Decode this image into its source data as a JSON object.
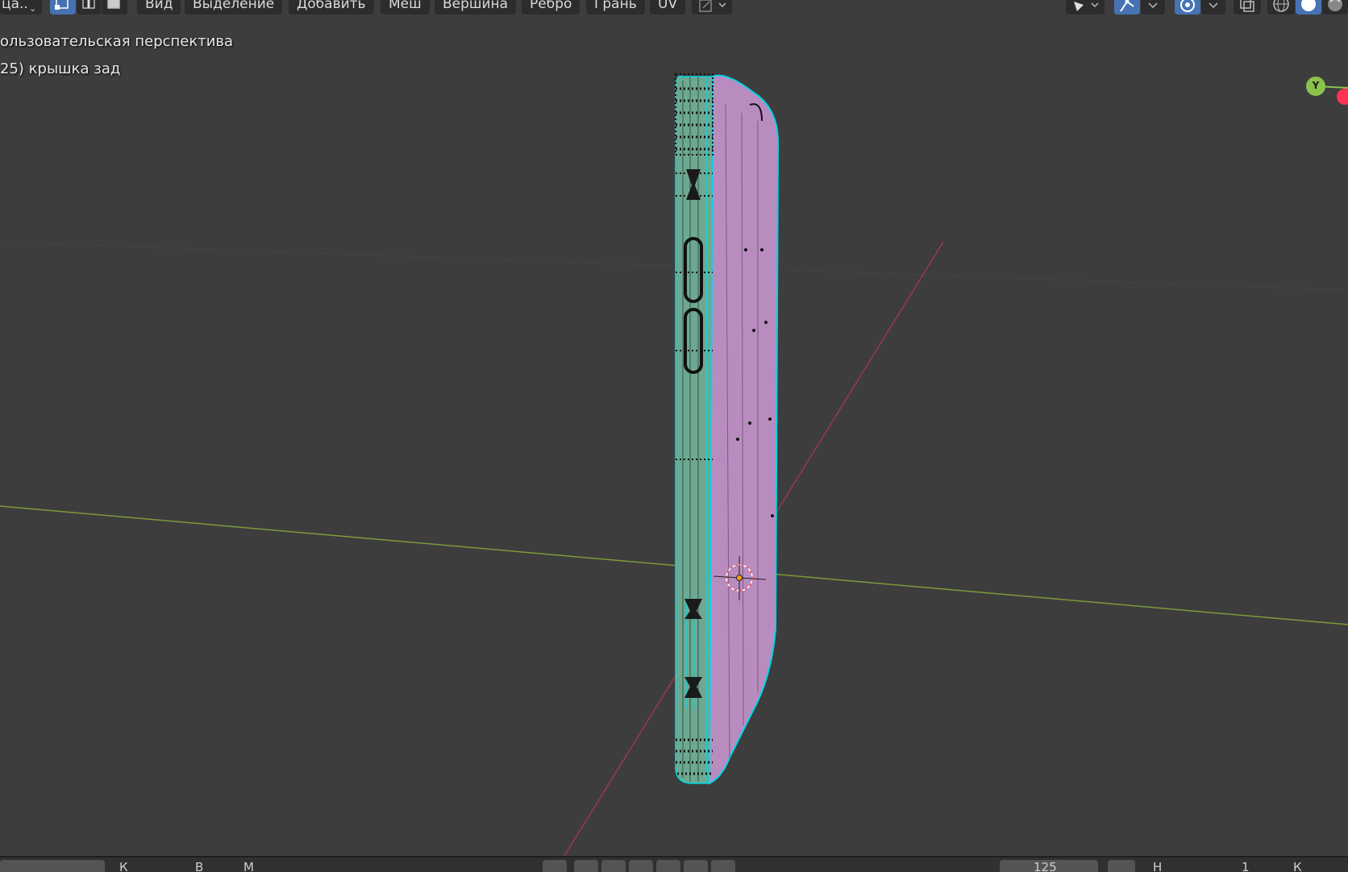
{
  "header": {
    "mode_label": "ца..",
    "menu": {
      "view": "Вид",
      "select": "Выделение",
      "add": "Добавить",
      "mesh": "Меш",
      "vertex": "Вершина",
      "edge": "Ребро",
      "face": "Грань",
      "uv": "UV"
    },
    "select_modes": [
      "vertex-select-icon",
      "edge-select-icon",
      "face-select-icon"
    ],
    "active_select_mode": "vertex",
    "right_icons": [
      "transform-pivot-icon",
      "snap-icon",
      "proportional-editing-icon",
      "overlay-icon",
      "wireframe-shading-icon",
      "solid-shading-icon",
      "material-shading-icon"
    ]
  },
  "viewport": {
    "perspective_label": "ользовательская перспектива",
    "object_label": "25) крышка зад"
  },
  "gizmo": {
    "y_label": "Y",
    "y_color": "#8bc34a",
    "x_color": "#ff3352"
  },
  "timeline": {
    "left_label": "К",
    "menu_label": "В",
    "menu_label_2": "М",
    "frame_value": "125",
    "right_text": "Н",
    "right_text_2": "1",
    "right_text_3": "К"
  },
  "colors": {
    "viewport_bg": "#3d3d3d",
    "face_side": "#6fa890",
    "face_back": "#b98cc0",
    "edge_selected": "#00d7e6",
    "axis_x": "#a83a4a",
    "axis_y": "#7d9a3a"
  }
}
